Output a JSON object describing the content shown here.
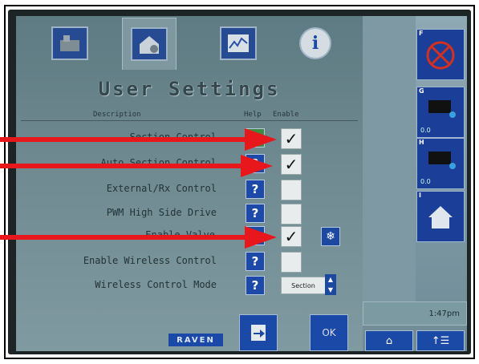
{
  "screen": {
    "title": "User Settings",
    "columns": {
      "description": "Description",
      "help": "Help",
      "enable": "Enable"
    },
    "rows": [
      {
        "label": "Section Control",
        "checked": true
      },
      {
        "label": "Auto Section Control",
        "checked": true
      },
      {
        "label": "External/Rx Control",
        "checked": false
      },
      {
        "label": "PWM High Side Drive",
        "checked": false
      },
      {
        "label": "Enable Valve",
        "checked": true
      },
      {
        "label": "Enable Wireless Control",
        "checked": false
      },
      {
        "label": "Wireless Control Mode",
        "select_value": "Section"
      }
    ],
    "help_symbol": "?",
    "check_symbol": "✓",
    "raven_label": "RAVEN",
    "ok_label": "OK"
  },
  "sidebar": {
    "buttons": [
      {
        "letter": "F",
        "icon": "no-boom-icon"
      },
      {
        "letter": "G",
        "icon": "sprayer-icon",
        "value": "0.0"
      },
      {
        "letter": "H",
        "icon": "sprayer-icon",
        "value": "0.0"
      },
      {
        "letter": "I",
        "icon": "home-icon"
      }
    ],
    "clock": "1:47pm"
  },
  "tabs": [
    {
      "icon": "machine-icon"
    },
    {
      "icon": "settings-icon"
    },
    {
      "icon": "diagnostics-icon"
    },
    {
      "icon": "info-icon"
    }
  ],
  "colors": {
    "accent": "#1b4aa6",
    "arrow": "#e8171b"
  }
}
